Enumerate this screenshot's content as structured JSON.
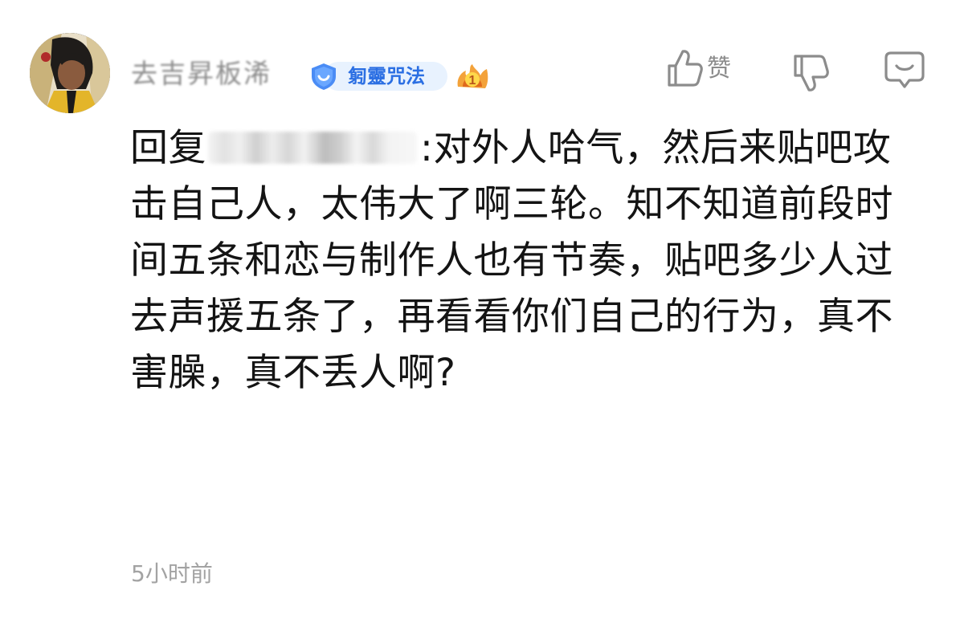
{
  "comment": {
    "author": {
      "name": "去吉昇板浠",
      "avatar": "avatar-image"
    },
    "badge": {
      "text": "匑靈咒法",
      "color": "#2b6fe3",
      "background": "#e8f2fe"
    },
    "level": {
      "value": "1"
    },
    "actions": {
      "like_label": "赞",
      "like_icon": "thumbs-up-icon",
      "dislike_icon": "thumbs-down-icon",
      "reply_icon": "reply-bubble-icon"
    },
    "reply_prefix": "回复",
    "text": ":对外人哈气，然后来贴吧攻击自己人，太伟大了啊三轮。知不知道前段时间五条和恋与制作人也有节奏，贴吧多少人过去声援五条了，再看看你们自己的行为，真不害臊，真不丢人啊?",
    "time": "5小时前"
  }
}
